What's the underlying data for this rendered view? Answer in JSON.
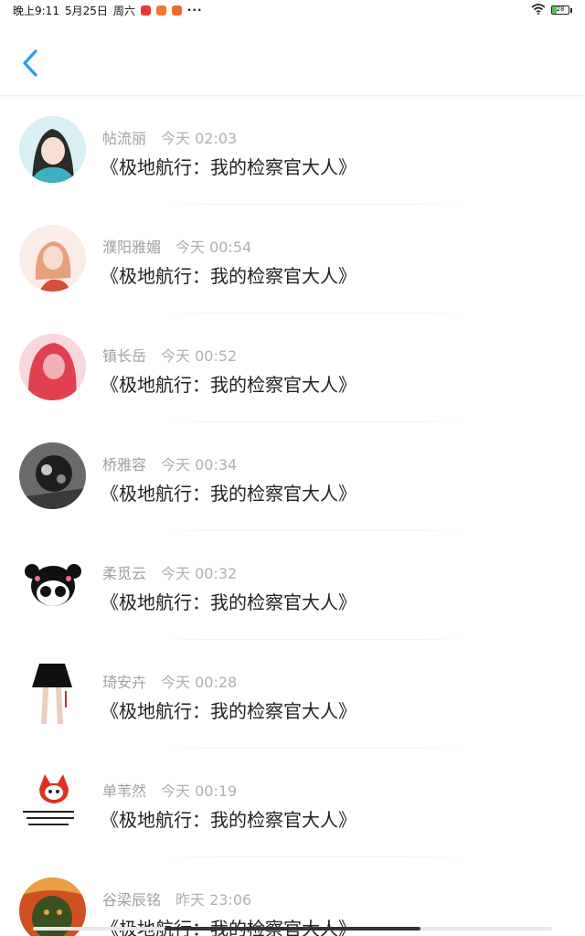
{
  "status_bar": {
    "time": "晚上9:11",
    "date": "5月25日",
    "weekday": "周六",
    "more": "···",
    "battery": "28",
    "app_icon_colors": [
      "#e83a3a",
      "#f07a2a",
      "#f06a2a"
    ]
  },
  "header": {
    "back_icon": "chevron-left-icon",
    "accent_color": "#2b9be8"
  },
  "list": [
    {
      "name": "帖流丽",
      "time": "今天 02:03",
      "title": "《极地航行：我的检察官大人》",
      "avatar_colors": [
        "#d9f0f5",
        "#2a2a2a",
        "#3bb0c0"
      ]
    },
    {
      "name": "濮阳雅媚",
      "time": "今天 00:54",
      "title": "《极地航行：我的检察官大人》",
      "avatar_colors": [
        "#fbece8",
        "#e8a07a",
        "#d0503a"
      ]
    },
    {
      "name": "镇长岳",
      "time": "今天 00:52",
      "title": "《极地航行：我的检察官大人》",
      "avatar_colors": [
        "#f4b0b8",
        "#e04050",
        "#f8d8dc"
      ]
    },
    {
      "name": "桥雅容",
      "time": "今天 00:34",
      "title": "《极地航行：我的检察官大人》",
      "avatar_colors": [
        "#6a6a6a",
        "#1e1e1e",
        "#c8c8c8"
      ]
    },
    {
      "name": "柔觅云",
      "time": "今天 00:32",
      "title": "《极地航行：我的检察官大人》",
      "avatar_colors": [
        "#ffffff",
        "#111111",
        "#ef6a9a"
      ]
    },
    {
      "name": "琦安卉",
      "time": "今天 00:28",
      "title": "《极地航行：我的检察官大人》",
      "avatar_colors": [
        "#ffffff",
        "#111111",
        "#e8cfc0"
      ]
    },
    {
      "name": "单苇然",
      "time": "今天 00:19",
      "title": "《极地航行：我的检察官大人》",
      "avatar_colors": [
        "#ffffff",
        "#e03020",
        "#222222"
      ]
    },
    {
      "name": "谷梁辰铭",
      "time": "昨天 23:06",
      "title": "《极地航行：我的检察官大人》",
      "avatar_colors": [
        "#d05020",
        "#3a5020",
        "#e8a040"
      ]
    }
  ]
}
